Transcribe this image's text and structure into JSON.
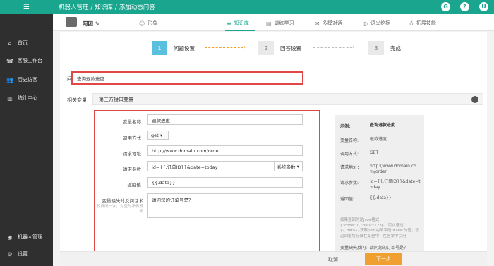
{
  "app": {
    "accent": "#1aa58f"
  },
  "breadcrumb": {
    "item1": "机器人管理",
    "sep": "/",
    "item2": "知识库",
    "item3": "添加动态问答"
  },
  "sidebar": {
    "items": [
      {
        "label": "首页",
        "icon": "home-icon",
        "glyph": "⌂"
      },
      {
        "label": "客服工作台",
        "icon": "support-icon",
        "glyph": "☎"
      },
      {
        "label": "历史访客",
        "icon": "users-icon",
        "glyph": "👥"
      },
      {
        "label": "统计中心",
        "icon": "chart-icon",
        "glyph": "▥"
      }
    ],
    "bottom_items": [
      {
        "label": "机器人管理",
        "icon": "robot-icon",
        "glyph": "◉"
      },
      {
        "label": "设置",
        "icon": "gear-icon",
        "glyph": "⚙"
      }
    ]
  },
  "bot": {
    "name": "阿团"
  },
  "tabs": [
    {
      "label": "形象",
      "icon": "face-icon",
      "glyph": "☺"
    },
    {
      "label": "知识库",
      "icon": "list-icon",
      "glyph": "≡"
    },
    {
      "label": "训练学习",
      "icon": "book-icon",
      "glyph": "▤"
    },
    {
      "label": "多模对话",
      "icon": "chat-icon",
      "glyph": "✉"
    },
    {
      "label": "语义挖掘",
      "icon": "mine-icon",
      "glyph": "◎"
    },
    {
      "label": "拓展技能",
      "icon": "bulb-icon",
      "glyph": "♁"
    }
  ],
  "steps": [
    {
      "num": "1",
      "label": "问题设置"
    },
    {
      "num": "2",
      "label": "回答设置"
    },
    {
      "num": "3",
      "label": "完成"
    }
  ],
  "question": {
    "label": "问题描述",
    "value": "查询退款进度"
  },
  "variables": {
    "label": "相关变量",
    "section_title": "第三方接口变量",
    "name_label": "变量名称",
    "name_value": "退款进度",
    "method_label": "调用方式",
    "method_value": "get",
    "url_label": "请求地址",
    "url_value": "http://www.domain.com/order",
    "params_label": "请求参数",
    "params_value": "id={{.订单ID}}&date=today",
    "params_button": "系统参数",
    "return_label": "返回值",
    "return_value": "{{.data}}",
    "ask_label": "变量缺失时反问话术",
    "ask_hint": "仅反问一次，为空时不做反问",
    "ask_value": "请问您的订单号是？"
  },
  "example": {
    "title_label": "示例:",
    "title_value": "查询退款进度",
    "name_label": "变量名称:",
    "name_value": "退款进度",
    "method_label": "调用方式:",
    "method_value": "GET",
    "url_label": "请求地址：",
    "url_value": "http://www.domain.com/order",
    "params_label": "请求参数:",
    "params_value": "id={{.订单ID}}&date=today",
    "return_label": "返回值:",
    "return_value": "{{.data}}",
    "note": "如果返回的是json格式：{\"code\":0,\"data\":123}，可以通过{{.data}}获取json内部字段\"data\"的值，该返回值将存储在变量中，在答案中引用",
    "ask_label": "变量缺失反问:",
    "ask_value": "请问您的订单号是？"
  },
  "footer": {
    "cancel": "取消",
    "next": "下一步"
  },
  "topbar_icons": {
    "github": "G",
    "help": "?",
    "user": "U"
  }
}
